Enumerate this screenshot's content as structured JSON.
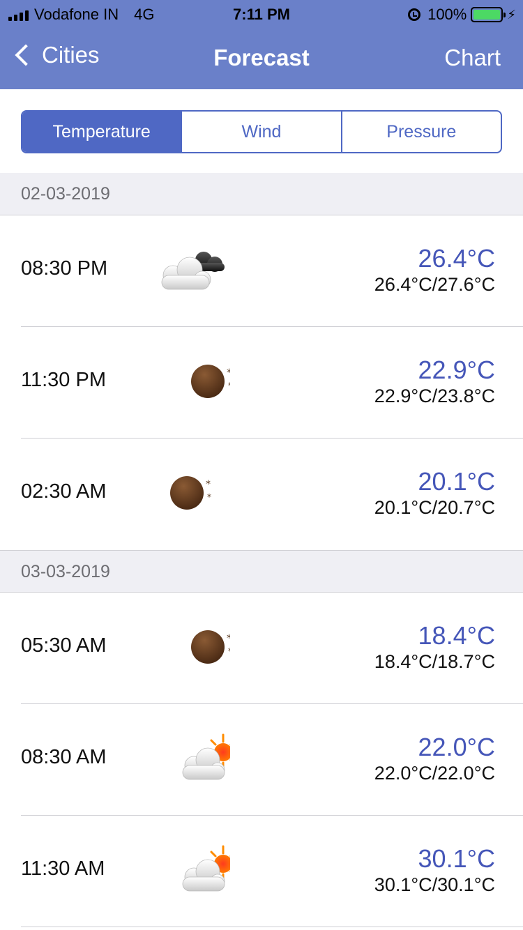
{
  "status_bar": {
    "carrier": "Vodafone IN",
    "network": "4G",
    "time": "7:11 PM",
    "battery": "100%",
    "battery_level": 1.0
  },
  "nav": {
    "back_label": "Cities",
    "title": "Forecast",
    "right_label": "Chart"
  },
  "tabs": [
    {
      "label": "Temperature",
      "selected": true
    },
    {
      "label": "Wind",
      "selected": false
    },
    {
      "label": "Pressure",
      "selected": false
    }
  ],
  "sections": [
    {
      "date": "02-03-2019",
      "rows": [
        {
          "time": "08:30 PM",
          "icon": "cloudy-night-icon",
          "temp": "26.4°C",
          "range": "26.4°C/27.6°C"
        },
        {
          "time": "11:30 PM",
          "icon": "moon-icon",
          "temp": "22.9°C",
          "range": "22.9°C/23.8°C"
        },
        {
          "time": "02:30 AM",
          "icon": "moon-icon",
          "temp": "20.1°C",
          "range": "20.1°C/20.7°C"
        }
      ]
    },
    {
      "date": "03-03-2019",
      "rows": [
        {
          "time": "05:30 AM",
          "icon": "moon-icon",
          "temp": "18.4°C",
          "range": "18.4°C/18.7°C"
        },
        {
          "time": "08:30 AM",
          "icon": "partly-sunny-icon",
          "temp": "22.0°C",
          "range": "22.0°C/22.0°C"
        },
        {
          "time": "11:30 AM",
          "icon": "partly-sunny-icon",
          "temp": "30.1°C",
          "range": "30.1°C/30.1°C"
        }
      ]
    }
  ],
  "colors": {
    "nav_bar": "#6a80c9",
    "accent": "#4f68c4",
    "temp_text": "#4556b8",
    "section_bg": "#efeff4"
  }
}
